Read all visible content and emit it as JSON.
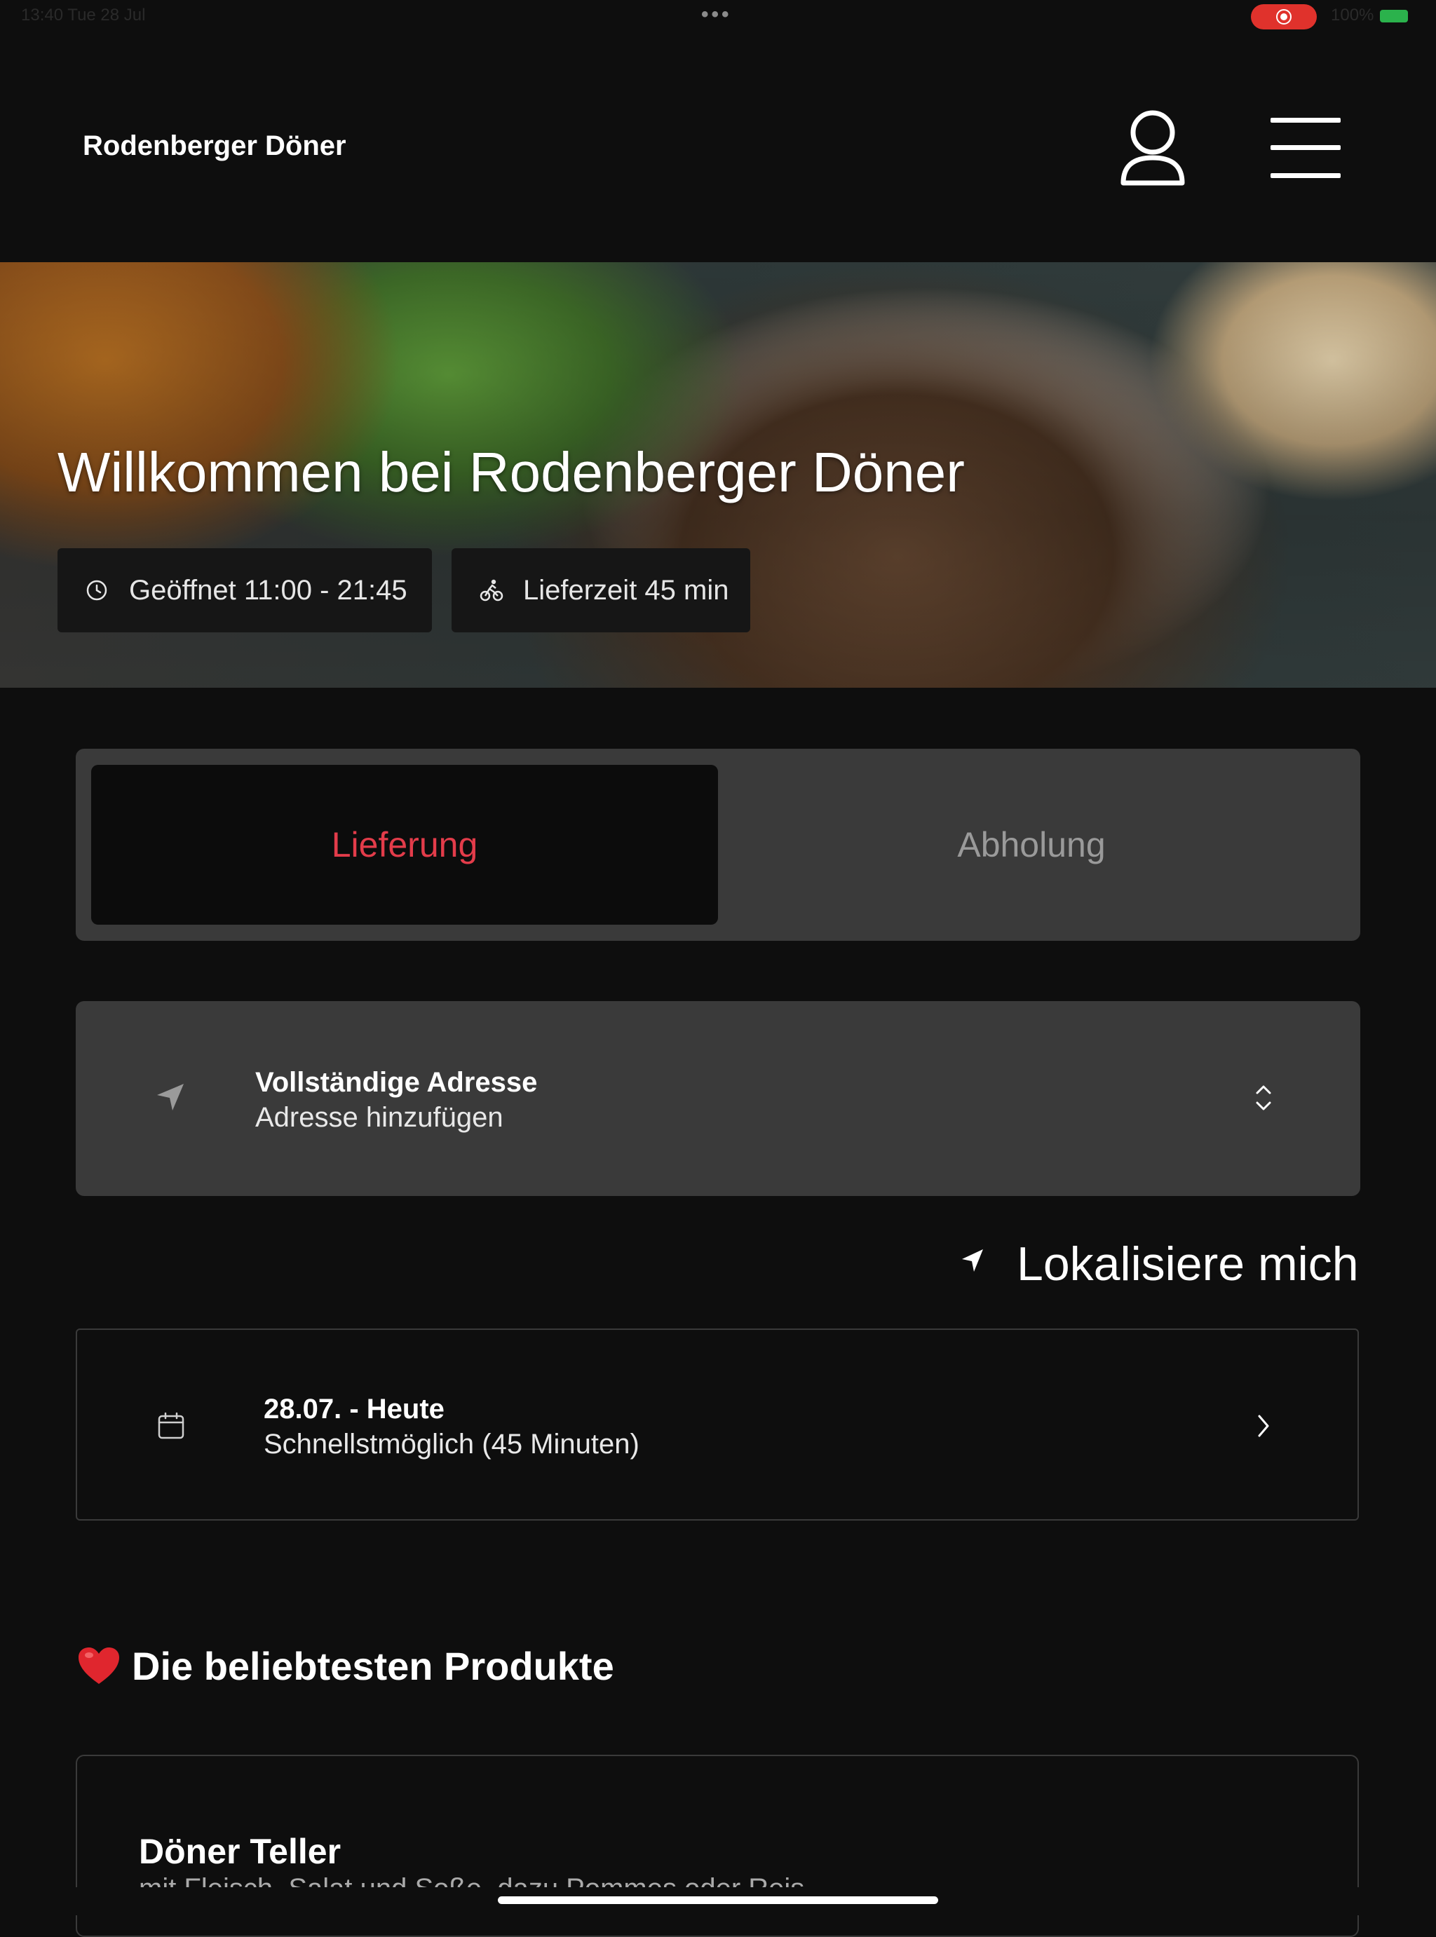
{
  "status_bar": {
    "time_date": "13:40   Tue 28 Jul",
    "dots": "•••",
    "battery": "100%"
  },
  "header": {
    "brand": "Rodenberger Döner"
  },
  "hero": {
    "title": "Willkommen bei Rodenberger Döner",
    "open_hours": "Geöffnet 11:00 - 21:45",
    "delivery_time": "Lieferzeit 45 min"
  },
  "mode_toggle": {
    "delivery": "Lieferung",
    "pickup": "Abholung",
    "selected": "delivery"
  },
  "address": {
    "title": "Vollständige Adresse",
    "placeholder": "Adresse hinzufügen"
  },
  "locate": {
    "label": "Lokalisiere mich"
  },
  "schedule": {
    "date": "28.07. - Heute",
    "time": "Schnellstmöglich (45 Minuten)"
  },
  "popular": {
    "title": "Die beliebtesten Produkte"
  },
  "products": [
    {
      "name": "Döner Teller",
      "description": "mit Fleisch, Salat und Soße, dazu Pommes oder Reis"
    }
  ],
  "colors": {
    "accent": "#e33c4a",
    "background": "#0e0e0e",
    "card": "#3a3a3a"
  }
}
